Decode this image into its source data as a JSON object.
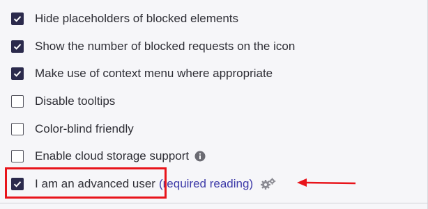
{
  "options": [
    {
      "label": "Hide placeholders of blocked elements",
      "checked": true
    },
    {
      "label": "Show the number of blocked requests on the icon",
      "checked": true
    },
    {
      "label": "Make use of context menu where appropriate",
      "checked": true
    },
    {
      "label": "Disable tooltips",
      "checked": false
    },
    {
      "label": "Color-blind friendly",
      "checked": false
    },
    {
      "label": "Enable cloud storage support",
      "checked": false,
      "info_icon": "info-icon"
    },
    {
      "label": "I am an advanced user",
      "checked": true,
      "link_open": "(",
      "link_text": "required reading",
      "link_close": ")",
      "settings_icon": "gears-icon"
    }
  ],
  "annotations": {
    "highlight_color": "#e8141b",
    "arrow_color": "#e8141b"
  },
  "colors": {
    "checkbox_checked": "#2b2a4c",
    "link": "#3d3aa8",
    "text": "#2e2e35",
    "background": "#f6f6f9"
  }
}
